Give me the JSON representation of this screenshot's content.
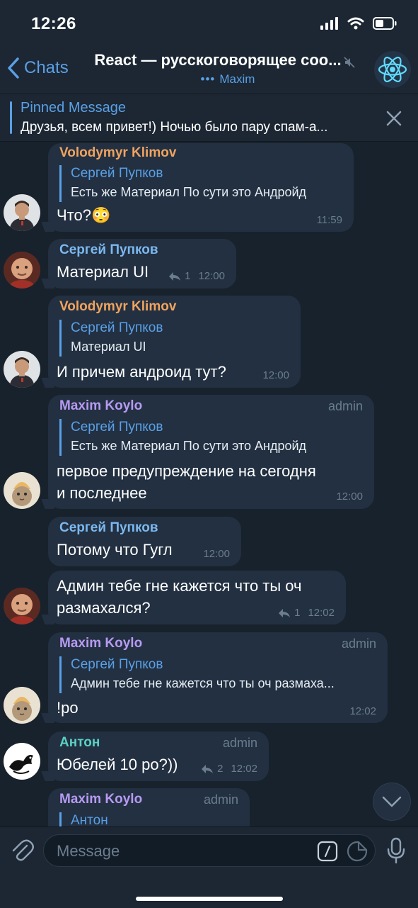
{
  "status": {
    "time": "12:26"
  },
  "nav": {
    "back_label": "Chats",
    "title": "React — русскоговорящее соо...",
    "subtitle": "Maxim"
  },
  "pinned": {
    "title": "Pinned Message",
    "text": "Друзья, всем привет!) Ночью было пару спам-а..."
  },
  "messages": [
    {
      "sender": "Volodymyr Klimov",
      "reply_name": "Сергей Пупков",
      "reply_text": "Есть же Материал По сути это Андройд",
      "text": "Что?😳",
      "time": "11:59"
    },
    {
      "sender": "Сергей Пупков",
      "text": "Материал UI",
      "replies": "1",
      "time": "12:00"
    },
    {
      "sender": "Volodymyr Klimov",
      "reply_name": "Сергей Пупков",
      "reply_text": "Материал UI",
      "text": "И причем андроид тут?",
      "time": "12:00"
    },
    {
      "sender": "Maxim Koylo",
      "badge": "admin",
      "reply_name": "Сергей Пупков",
      "reply_text": "Есть же Материал По сути это Андройд",
      "text_line1": "первое предупреждение на сегодня",
      "text_line2": "и последнее",
      "time": "12:00"
    },
    {
      "sender": "Сергей Пупков",
      "text": "Потому что Гугл",
      "time": "12:00"
    },
    {
      "text_line1": "Админ тебе гне кажется что ты оч",
      "text_line2": "размахался?",
      "replies": "1",
      "time": "12:02"
    },
    {
      "sender": "Maxim Koylo",
      "badge": "admin",
      "reply_name": "Сергей Пупков",
      "reply_text": "Админ тебе гне кажется что ты оч размаха...",
      "text": "!ро",
      "time": "12:02"
    },
    {
      "sender": "Антон",
      "badge": "admin",
      "text": "Юбелей 10 ро?))",
      "replies": "2",
      "time": "12:02"
    },
    {
      "sender": "Maxim Koylo",
      "badge": "admin",
      "reply_name": "Антон"
    }
  ],
  "input": {
    "placeholder": "Message"
  },
  "colors": {
    "background": "#18222d",
    "bubble": "#223041",
    "accent": "#5aa0e6",
    "sender_volodymyr": "#f0a35e",
    "sender_sergey": "#7cb8ef",
    "sender_maxim": "#b79af2",
    "sender_anton": "#5ad1c4"
  },
  "icons": [
    "back-chevron-icon",
    "mute-icon",
    "react-logo-icon",
    "close-icon",
    "reply-arrow-icon",
    "chevron-down-icon",
    "paperclip-icon",
    "slash-command-icon",
    "sticker-icon",
    "microphone-icon"
  ]
}
